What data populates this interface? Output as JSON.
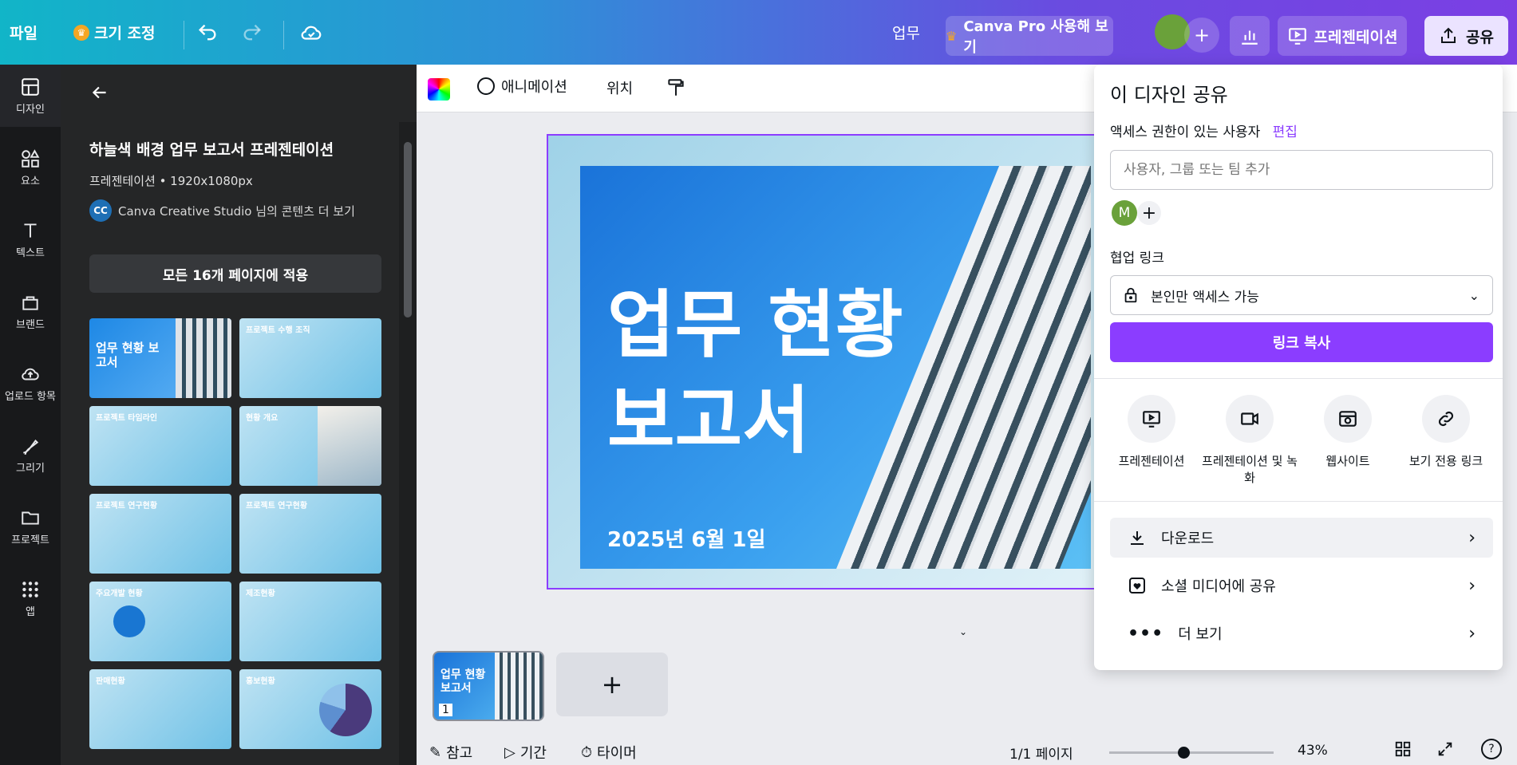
{
  "topbar": {
    "file_label": "파일",
    "resize_label": "크기 조정",
    "doc_title_partial": "업무",
    "pro_label": "Canva Pro 사용해 보기",
    "present_label": "프레젠테이션",
    "share_label": "공유",
    "crown_color": "#f5a623"
  },
  "rail": {
    "items": [
      {
        "label": "디자인",
        "icon": "layout-icon"
      },
      {
        "label": "요소",
        "icon": "shapes-icon"
      },
      {
        "label": "텍스트",
        "icon": "text-icon"
      },
      {
        "label": "브랜드",
        "icon": "brand-icon"
      },
      {
        "label": "업로드 항목",
        "icon": "upload-icon"
      },
      {
        "label": "그리기",
        "icon": "draw-icon"
      },
      {
        "label": "프로젝트",
        "icon": "folder-icon"
      },
      {
        "label": "앱",
        "icon": "apps-icon"
      }
    ]
  },
  "panel": {
    "title": "하늘색 배경 업무 보고서 프레젠테이션",
    "meta": "프레젠테이션 • 1920x1080px",
    "author_initials": "CC",
    "author_text": "Canva Creative Studio 님의 콘텐츠 더 보기",
    "apply_all": "모든 16개 페이지에 적용",
    "templates": [
      {
        "title": "업무 현황 보고서"
      },
      {
        "title": "프로젝트 수행 조직"
      },
      {
        "title": "프로젝트 타임라인"
      },
      {
        "title": "현황 개요"
      },
      {
        "title": "프로젝트 연구현황"
      },
      {
        "title": "프로젝트 연구현황"
      },
      {
        "title": "주요개발 현황"
      },
      {
        "title": "제조현황"
      },
      {
        "title": "판매현황"
      },
      {
        "title": "홍보현황"
      }
    ]
  },
  "ctx_toolbar": {
    "animation": "애니메이션",
    "position": "위치"
  },
  "slide": {
    "title_line1": "업무 현황",
    "title_line2": "보고서",
    "date": "2025년 6월 1일"
  },
  "share": {
    "heading": "이 디자인 공유",
    "access_label": "액세스 권한이 있는 사용자",
    "edit_label": "편집",
    "input_placeholder": "사용자, 그룹 또는 팀 추가",
    "avatar_initial": "M",
    "collab_label": "협업 링크",
    "access_value": "본인만 액세스 가능",
    "copy_link": "링크 복사",
    "options": [
      {
        "label": "프레젠테이션",
        "icon": "present-icon"
      },
      {
        "label": "프레젠테이션 및 녹화",
        "icon": "record-icon"
      },
      {
        "label": "웹사이트",
        "icon": "website-icon"
      },
      {
        "label": "보기 전용 링크",
        "icon": "link-icon"
      }
    ],
    "rows": [
      {
        "label": "다운로드",
        "icon": "download-icon"
      },
      {
        "label": "소셜 미디어에 공유",
        "icon": "heart-icon"
      },
      {
        "label": "더 보기",
        "icon": "more-icon"
      }
    ],
    "accent": "#8b3dff"
  },
  "pages": {
    "page_number": "1",
    "thumb_title": "업무 현황 보고서"
  },
  "bottombar": {
    "notes": "참고",
    "duration": "기간",
    "timer": "타이머",
    "page_count": "1/1 페이지",
    "zoom": "43%",
    "help": "?"
  }
}
